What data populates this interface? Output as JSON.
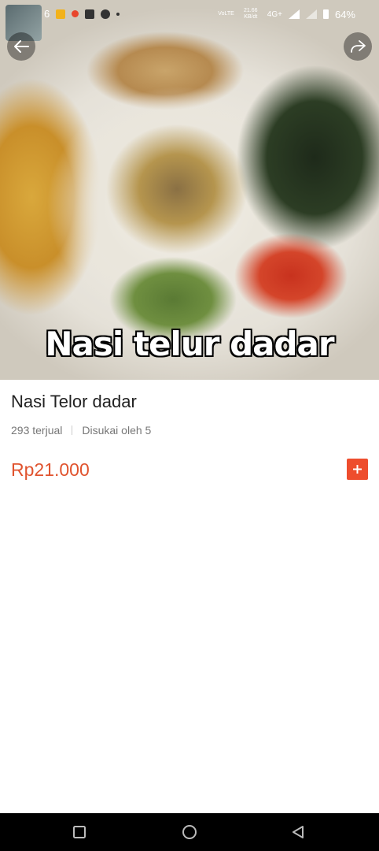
{
  "status_bar": {
    "left_number": "6",
    "network_speed": "21.66 KB/dt",
    "network_type": "4G+",
    "battery": "64%"
  },
  "product": {
    "image_caption": "Nasi telur dadar",
    "name": "Nasi Telor dadar",
    "sold": "293 terjual",
    "liked_by": "Disukai oleh 5",
    "price": "Rp21.000"
  },
  "colors": {
    "accent": "#ee4d2d",
    "price": "#e0532e"
  },
  "icons": {
    "back": "arrow-left-icon",
    "share": "share-icon",
    "add": "plus-icon",
    "nav_recent": "square-icon",
    "nav_home": "circle-icon",
    "nav_back": "triangle-back-icon"
  }
}
